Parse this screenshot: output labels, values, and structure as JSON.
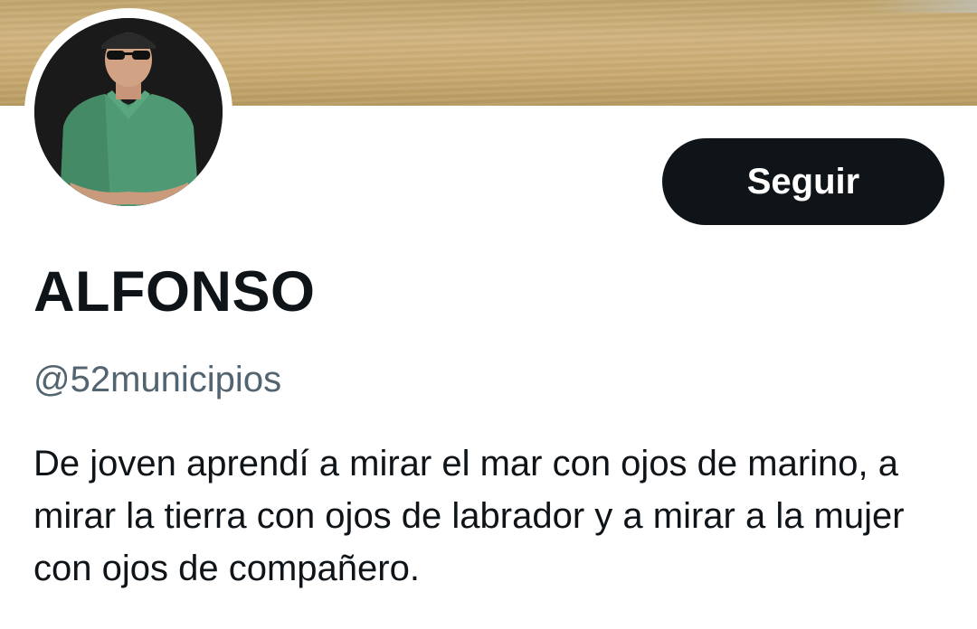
{
  "profile": {
    "display_name": "ALFONSO",
    "handle": "@52municipios",
    "bio": "De joven aprendí a mirar el mar con ojos de marino, a mirar la tierra con ojos de labrador y a mirar a la mujer con ojos de compañero.",
    "avatar_alt": "profile-photo",
    "banner": "sand-beach-banner"
  },
  "actions": {
    "follow_label": "Seguir"
  },
  "colors": {
    "primary_text": "#0f1419",
    "secondary_text": "#536471",
    "button_bg": "#0f1419",
    "button_text": "#ffffff",
    "background": "#ffffff",
    "banner_sand": "#c8a96f"
  }
}
